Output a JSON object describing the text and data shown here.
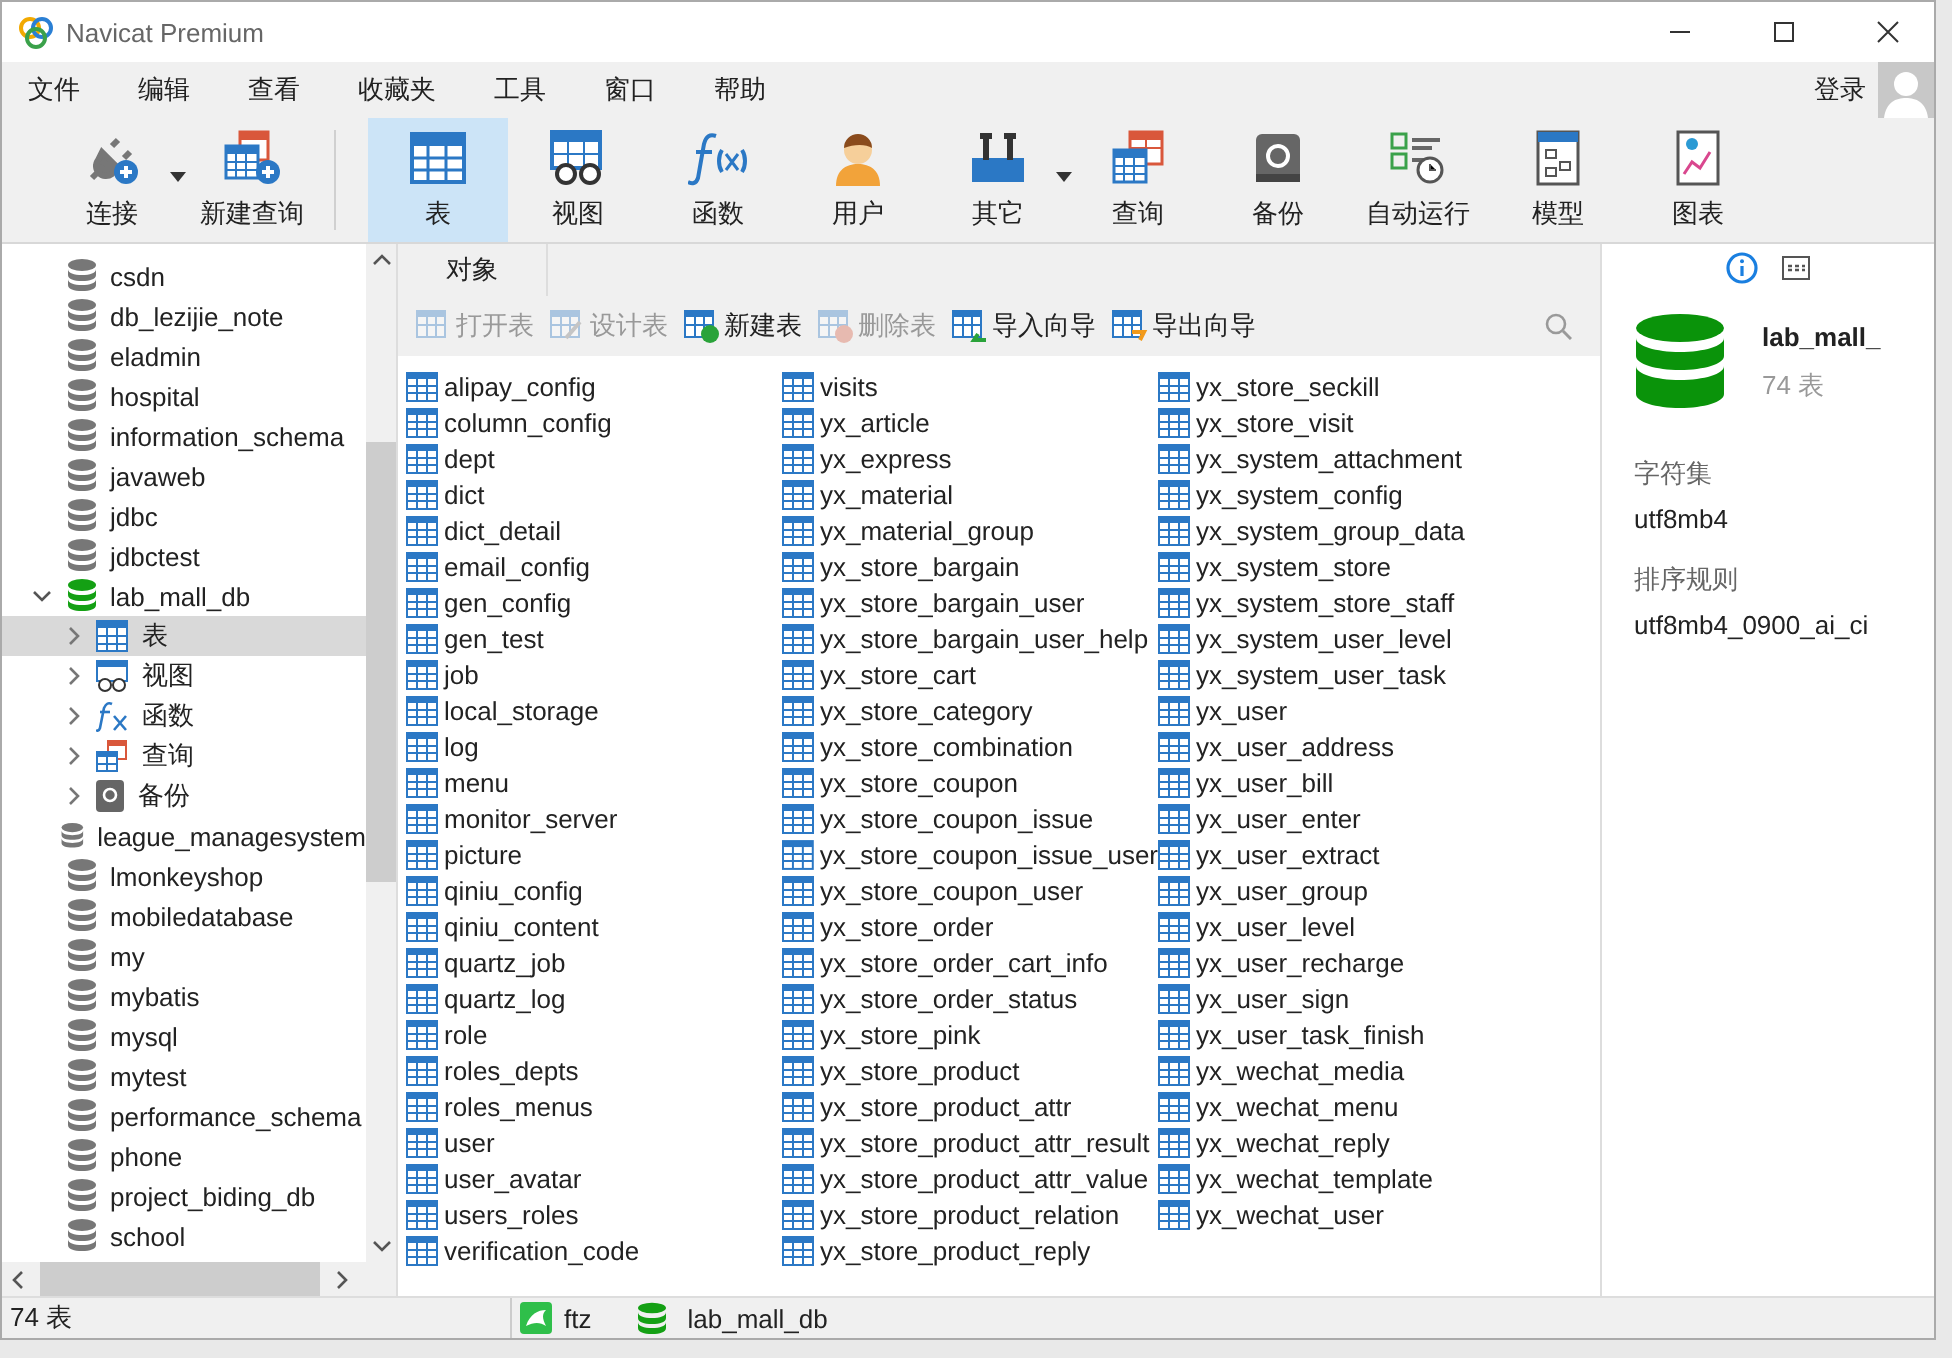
{
  "window": {
    "title": "Navicat Premium"
  },
  "menu": [
    "文件",
    "编辑",
    "查看",
    "收藏夹",
    "工具",
    "窗口",
    "帮助"
  ],
  "login": "登录",
  "toolbar": [
    {
      "kind": "connect",
      "label": "连接",
      "dropdown": true,
      "selected": false
    },
    {
      "kind": "newquery",
      "label": "新建查询",
      "dropdown": false,
      "selected": false
    },
    {
      "kind": "table",
      "label": "表",
      "dropdown": false,
      "selected": true
    },
    {
      "kind": "view",
      "label": "视图",
      "dropdown": false,
      "selected": false
    },
    {
      "kind": "function",
      "label": "函数",
      "dropdown": false,
      "selected": false
    },
    {
      "kind": "user",
      "label": "用户",
      "dropdown": false,
      "selected": false
    },
    {
      "kind": "other",
      "label": "其它",
      "dropdown": true,
      "selected": false
    },
    {
      "kind": "query",
      "label": "查询",
      "dropdown": false,
      "selected": false
    },
    {
      "kind": "backup",
      "label": "备份",
      "dropdown": false,
      "selected": false
    },
    {
      "kind": "schedule",
      "label": "自动运行",
      "dropdown": false,
      "selected": false
    },
    {
      "kind": "model",
      "label": "模型",
      "dropdown": false,
      "selected": false
    },
    {
      "kind": "chart",
      "label": "图表",
      "dropdown": false,
      "selected": false
    }
  ],
  "sidebar": {
    "items": [
      {
        "label": "csdn",
        "active": false,
        "expanded": false
      },
      {
        "label": "db_lezijie_note",
        "active": false,
        "expanded": false
      },
      {
        "label": "eladmin",
        "active": false,
        "expanded": false
      },
      {
        "label": "hospital",
        "active": false,
        "expanded": false
      },
      {
        "label": "information_schema",
        "active": false,
        "expanded": false
      },
      {
        "label": "javaweb",
        "active": false,
        "expanded": false
      },
      {
        "label": "jdbc",
        "active": false,
        "expanded": false
      },
      {
        "label": "jdbctest",
        "active": false,
        "expanded": false
      },
      {
        "label": "lab_mall_db",
        "active": true,
        "expanded": true,
        "children": [
          {
            "kind": "table",
            "label": "表",
            "selected": true
          },
          {
            "kind": "view",
            "label": "视图",
            "selected": false
          },
          {
            "kind": "function",
            "label": "函数",
            "selected": false
          },
          {
            "kind": "query",
            "label": "查询",
            "selected": false
          },
          {
            "kind": "backup",
            "label": "备份",
            "selected": false
          }
        ]
      },
      {
        "label": "league_managesystem",
        "active": false,
        "expanded": false
      },
      {
        "label": "lmonkeyshop",
        "active": false,
        "expanded": false
      },
      {
        "label": "mobiledatabase",
        "active": false,
        "expanded": false
      },
      {
        "label": "my",
        "active": false,
        "expanded": false
      },
      {
        "label": "mybatis",
        "active": false,
        "expanded": false
      },
      {
        "label": "mysql",
        "active": false,
        "expanded": false
      },
      {
        "label": "mytest",
        "active": false,
        "expanded": false
      },
      {
        "label": "performance_schema",
        "active": false,
        "expanded": false
      },
      {
        "label": "phone",
        "active": false,
        "expanded": false
      },
      {
        "label": "project_biding_db",
        "active": false,
        "expanded": false
      },
      {
        "label": "school",
        "active": false,
        "expanded": false
      }
    ]
  },
  "tabs": [
    {
      "label": "对象",
      "selected": true
    }
  ],
  "object_toolbar": [
    {
      "kind": "open",
      "label": "打开表",
      "disabled": true
    },
    {
      "kind": "design",
      "label": "设计表",
      "disabled": true
    },
    {
      "kind": "new",
      "label": "新建表",
      "disabled": false
    },
    {
      "kind": "delete",
      "label": "删除表",
      "disabled": true
    },
    {
      "kind": "import",
      "label": "导入向导",
      "disabled": false
    },
    {
      "kind": "export",
      "label": "导出向导",
      "disabled": false
    }
  ],
  "tables": [
    "alipay_config",
    "column_config",
    "dept",
    "dict",
    "dict_detail",
    "email_config",
    "gen_config",
    "gen_test",
    "job",
    "local_storage",
    "log",
    "menu",
    "monitor_server",
    "picture",
    "qiniu_config",
    "qiniu_content",
    "quartz_job",
    "quartz_log",
    "role",
    "roles_depts",
    "roles_menus",
    "user",
    "user_avatar",
    "users_roles",
    "verification_code",
    "visits",
    "yx_article",
    "yx_express",
    "yx_material",
    "yx_material_group",
    "yx_store_bargain",
    "yx_store_bargain_user",
    "yx_store_bargain_user_help",
    "yx_store_cart",
    "yx_store_category",
    "yx_store_combination",
    "yx_store_coupon",
    "yx_store_coupon_issue",
    "yx_store_coupon_issue_user",
    "yx_store_coupon_user",
    "yx_store_order",
    "yx_store_order_cart_info",
    "yx_store_order_status",
    "yx_store_pink",
    "yx_store_product",
    "yx_store_product_attr",
    "yx_store_product_attr_result",
    "yx_store_product_attr_value",
    "yx_store_product_relation",
    "yx_store_product_reply",
    "yx_store_seckill",
    "yx_store_visit",
    "yx_system_attachment",
    "yx_system_config",
    "yx_system_group_data",
    "yx_system_store",
    "yx_system_store_staff",
    "yx_system_user_level",
    "yx_system_user_task",
    "yx_user",
    "yx_user_address",
    "yx_user_bill",
    "yx_user_enter",
    "yx_user_extract",
    "yx_user_group",
    "yx_user_level",
    "yx_user_recharge",
    "yx_user_sign",
    "yx_user_task_finish",
    "yx_wechat_media",
    "yx_wechat_menu",
    "yx_wechat_reply",
    "yx_wechat_template",
    "yx_wechat_user"
  ],
  "info_panel": {
    "name": "lab_mall_",
    "count": "74 表",
    "fields": [
      {
        "label": "字符集",
        "value": "utf8mb4"
      },
      {
        "label": "排序规则",
        "value": "utf8mb4_0900_ai_ci"
      }
    ]
  },
  "status_bar": {
    "count": "74 表",
    "user": "ftz",
    "database": "lab_mall_db"
  }
}
